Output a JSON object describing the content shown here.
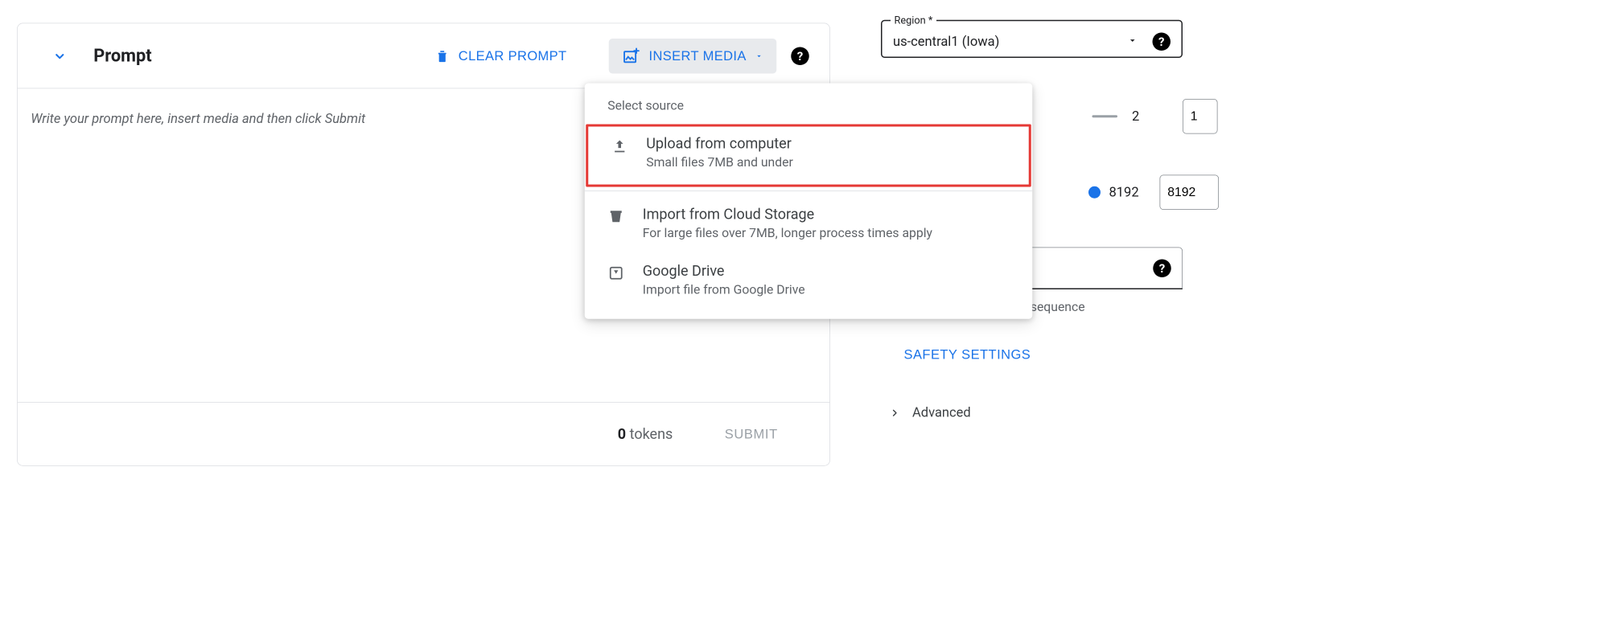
{
  "prompt": {
    "title": "Prompt",
    "clear_label": "CLEAR PROMPT",
    "insert_media_label": "INSERT MEDIA",
    "placeholder": "Write your prompt here, insert media and then click Submit",
    "token_count": "0",
    "token_word": "tokens",
    "submit_label": "SUBMIT"
  },
  "media_menu": {
    "title": "Select source",
    "items": [
      {
        "label": "Upload from computer",
        "desc": "Small files 7MB and under"
      },
      {
        "label": "Import from Cloud Storage",
        "desc": "For large files over 7MB, longer process times apply"
      },
      {
        "label": "Google Drive",
        "desc": "Import file from Google Drive"
      }
    ]
  },
  "sidebar": {
    "region_legend": "Region *",
    "region_value": "us-central1 (Iowa)",
    "param1_display": "2",
    "param1_value": "1",
    "param2_display": "8192",
    "param2_value": "8192",
    "stop_seq_visible_char": "e",
    "stop_seq_hint": "ch sequence",
    "safety_label": "SAFETY SETTINGS",
    "advanced_label": "Advanced"
  }
}
